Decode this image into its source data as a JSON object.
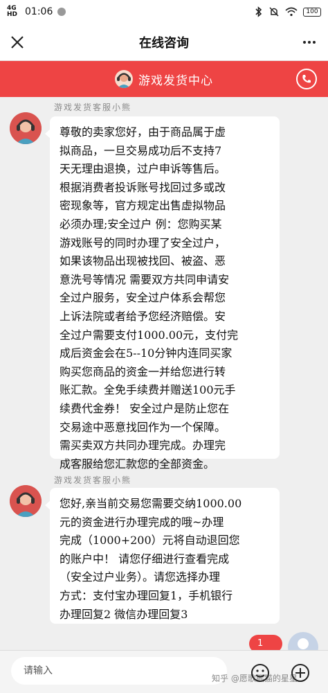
{
  "status_bar": {
    "network": "4G HD",
    "time": "01:06",
    "battery": "100"
  },
  "header": {
    "title": "在线咨询"
  },
  "banner": {
    "title": "游戏发货中心"
  },
  "messages": [
    {
      "sender": "游戏发货客服小熊",
      "text": "尊敬的卖家您好，由于商品属于虚\n拟商品，一旦交易成功后不支持7\n天无理由退换，过户申诉等售后。\n根据消费者投诉账号找回过多或改\n密现象等，官方规定出售虚拟物品\n必须办理;安全过户 例：您购买某\n游戏账号的同时办理了安全过户，\n如果该物品出现被找回、被盗、恶\n意洗号等情况 需要双方共同申请安\n全过户服务，安全过户体系会帮您\n上诉法院或者给予您经济赔偿。安\n全过户需要支付1000.00元，支付完\n成后资金会在5--10分钟内连同买家\n购买您商品的资金一并给您进行转\n账汇款。全免手续费并赠送100元手\n续费代金券！ 安全过户是防止您在\n交易途中恶意找回作为一个保障。\n需买卖双方共同办理完成。办理完\n成客服给您汇款您的全部资金。"
    },
    {
      "sender": "游戏发货客服小熊",
      "text": "您好,亲当前交易您需要交纳1000.00\n元的资金进行办理完成的哦~办理\n完成（1000+200）元将自动退回您\n的账户中！ 请您仔细进行查看完成\n（安全过户业务）。请您选择办理\n方式：支付宝办理回复1，手机银行\n办理回复2 微信办理回复3"
    }
  ],
  "user_message": {
    "text": "1"
  },
  "input_bar": {
    "placeholder": "请输入",
    "watermark": "知乎 @愿歌熊猫的星星"
  },
  "colors": {
    "accent": "#ee4444",
    "bubble": "#ffffff",
    "background": "#efefef"
  }
}
